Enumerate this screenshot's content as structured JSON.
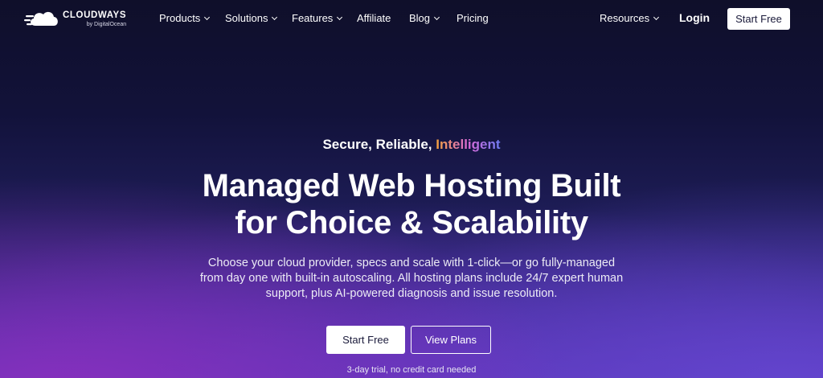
{
  "brand": {
    "name": "CLOUDWAYS",
    "sub": "by DigitalOcean"
  },
  "nav": {
    "items": [
      {
        "label": "Products",
        "dropdown": true
      },
      {
        "label": "Solutions",
        "dropdown": true
      },
      {
        "label": "Features",
        "dropdown": true
      },
      {
        "label": "Affiliate",
        "dropdown": false
      },
      {
        "label": "Blog",
        "dropdown": true
      },
      {
        "label": "Pricing",
        "dropdown": false
      }
    ],
    "resources_label": "Resources",
    "login_label": "Login",
    "start_label": "Start Free"
  },
  "hero": {
    "tagline_prefix": "Secure, Reliable, ",
    "tagline_accent": "Intelligent",
    "headline_line1": "Managed Web Hosting Built",
    "headline_line2": "for Choice & Scalability",
    "subtext_line1": "Choose your cloud provider, specs and scale with 1-click—or go fully-managed",
    "subtext_line2": "from day one with built-in autoscaling. All hosting plans include 24/7 expert human",
    "subtext_line3": "support, plus AI-powered diagnosis and issue resolution.",
    "primary_button": "Start Free",
    "secondary_button": "View Plans",
    "note": "3-day trial, no credit card needed"
  },
  "colors": {
    "background_top": "#0f0f2a",
    "background_bottom": "#5a3ab4",
    "accent_gradient": [
      "#f4a23c",
      "#d96ad6",
      "#6d7cf5"
    ]
  },
  "icons": {
    "logo": "cloud-logo-icon",
    "dropdown": "chevron-down-icon"
  }
}
